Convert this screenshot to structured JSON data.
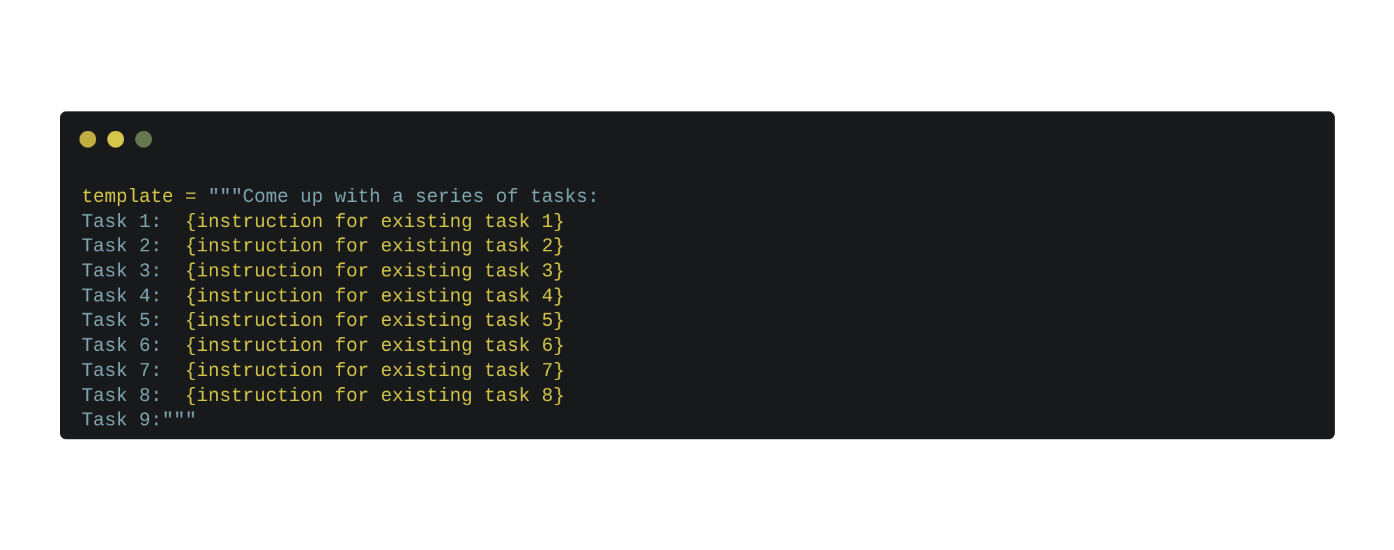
{
  "window": {
    "controls": [
      {
        "name": "close-control",
        "color": "#c2ad40"
      },
      {
        "name": "minimize-control",
        "color": "#d6c74a"
      },
      {
        "name": "maximize-control",
        "color": "#667850"
      }
    ]
  },
  "code": {
    "first_line": {
      "variable": "template",
      "operator": " = ",
      "string_open": "\"\"\"",
      "text": "Come up with a series of tasks:"
    },
    "tasks": [
      {
        "label": "Task 1:",
        "instruction": "{instruction for existing task 1}"
      },
      {
        "label": "Task 2:",
        "instruction": "{instruction for existing task 2}"
      },
      {
        "label": "Task 3:",
        "instruction": "{instruction for existing task 3}"
      },
      {
        "label": "Task 4:",
        "instruction": "{instruction for existing task 4}"
      },
      {
        "label": "Task 5:",
        "instruction": "{instruction for existing task 5}"
      },
      {
        "label": "Task 6:",
        "instruction": "{instruction for existing task 6}"
      },
      {
        "label": "Task 7:",
        "instruction": "{instruction for existing task 7}"
      },
      {
        "label": "Task 8:",
        "instruction": "{instruction for existing task 8}"
      }
    ],
    "last_line": {
      "label": "Task 9:",
      "string_close": "\"\"\""
    }
  },
  "colors": {
    "background": "#18191b",
    "keyword_yellow": "#d6c74a",
    "string_teal": "#7fa7b2"
  }
}
